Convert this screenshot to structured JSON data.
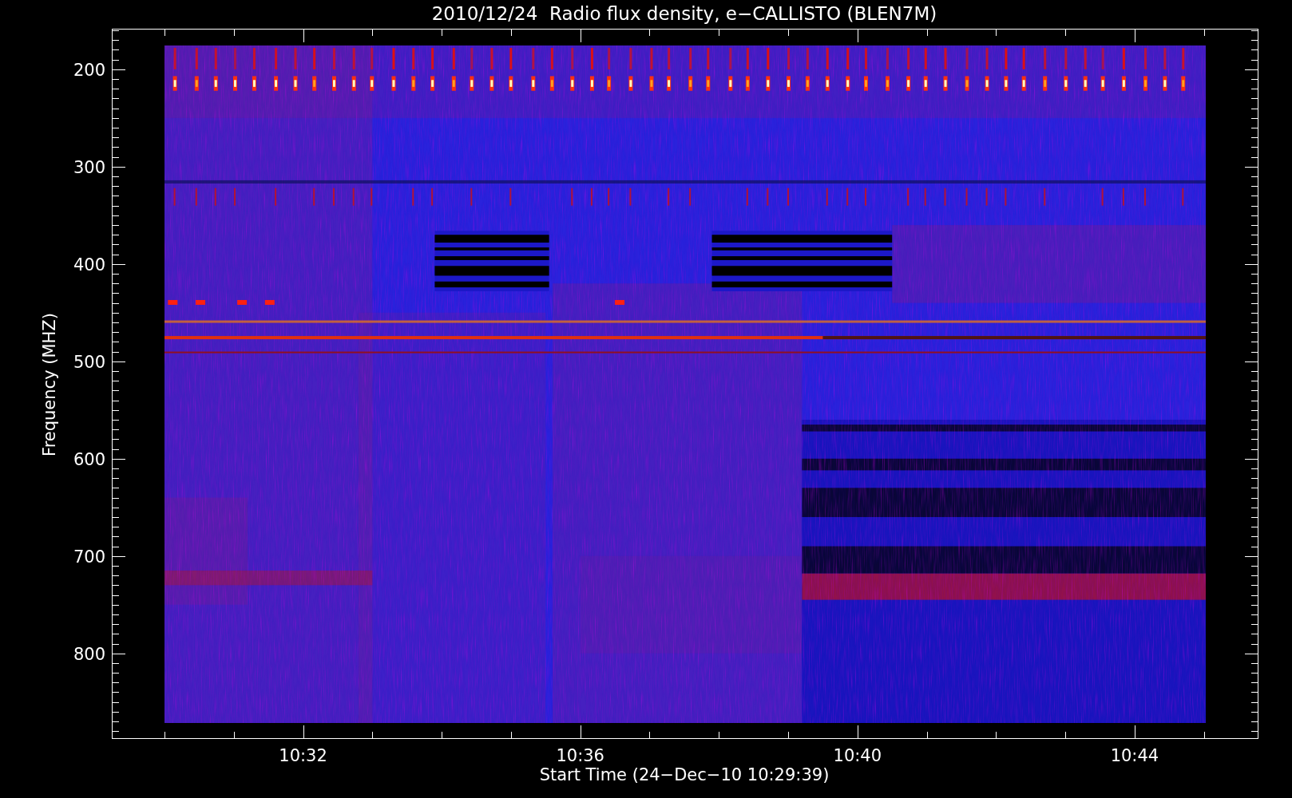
{
  "chart": {
    "title": "2010/12/24  Radio flux density, e−CALLISTO (BLEN7M)",
    "ylabel": "Frequency (MHZ)",
    "xlabel": "Start Time (24−Dec−10 10:29:39)",
    "yticks": [
      "200",
      "300",
      "400",
      "500",
      "600",
      "700",
      "800"
    ],
    "xticks": [
      "10:32",
      "10:36",
      "10:40",
      "10:44"
    ]
  }
}
